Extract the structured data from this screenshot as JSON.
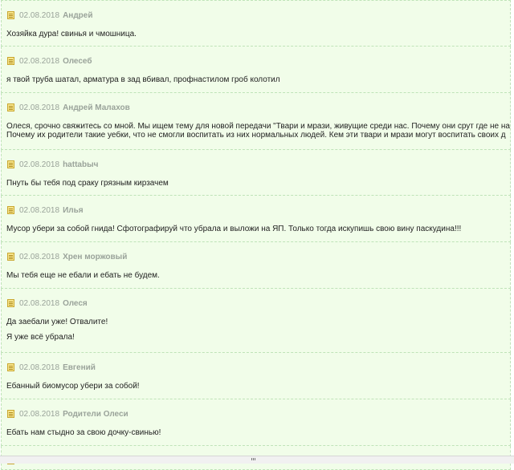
{
  "comments": [
    {
      "date": "02.08.2018",
      "author": "Андрей",
      "lines": [
        "Хозяйка дура! свинья и чмошница."
      ]
    },
    {
      "date": "02.08.2018",
      "author": "Олесеб",
      "lines": [
        "я твой труба шатал, арматура в зад вбивал, профнастилом гроб колотил"
      ]
    },
    {
      "date": "02.08.2018",
      "author": "Андрей Малахов",
      "lines": [
        "Олеся, срочно свяжитесь со мной. Мы ищем тему для новой передачи \"Твари и мрази, живущие среди нас. Почему они срут где не надо.",
        "Почему их родители такие уебки, что не смогли воспитать из них нормальных людей. Кем эти твари и мрази могут воспитать своих д"
      ]
    },
    {
      "date": "02.08.2018",
      "author": "hattabыч",
      "lines": [
        "Пнуть бы тебя под сраку грязным кирзачем"
      ]
    },
    {
      "date": "02.08.2018",
      "author": "Илья",
      "lines": [
        "Мусор убери за собой гнида! Сфотографируй что убрала и выложи на ЯП. Только тогда искупишь свою вину паскудина!!!"
      ]
    },
    {
      "date": "02.08.2018",
      "author": "Хрен моржовый",
      "lines": [
        "Мы тебя еще не ебали и ебать не будем."
      ]
    },
    {
      "date": "02.08.2018",
      "author": "Олеся",
      "lines": [
        "Да заебали уже! Отвалите!",
        "Я уже всё убрала!"
      ],
      "paragraphs": true
    },
    {
      "date": "02.08.2018",
      "author": "Евгений",
      "lines": [
        "Ебанный биомусор убери за собой!"
      ]
    },
    {
      "date": "02.08.2018",
      "author": "Родители Олеси",
      "lines": [
        "Ебать нам стыдно за свою дочку-свинью!"
      ]
    },
    {
      "date": "02.08.2018",
      "author": "",
      "lines": []
    }
  ]
}
